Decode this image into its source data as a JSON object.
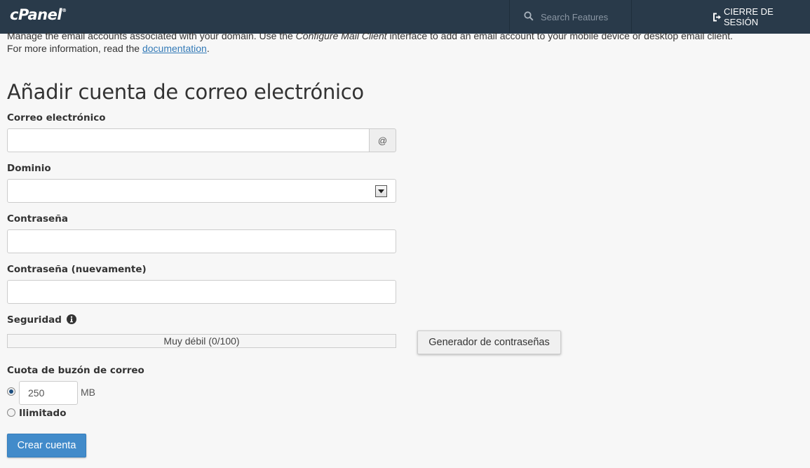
{
  "header": {
    "brand": "cPanel",
    "search_placeholder": "Search Features",
    "logout_label": "CIERRE DE SESIÓN"
  },
  "intro": {
    "line1_part1": "Manage the email accounts associated with your domain. Use the ",
    "line1_em": "Configure Mail Client",
    "line1_part2": " interface to add an email account to your mobile device or desktop email client.",
    "line2_prefix": "For more information, read the ",
    "link_text": "documentation",
    "line2_suffix": "."
  },
  "form": {
    "title": "Añadir cuenta de correo electrónico",
    "email_label": "Correo electrónico",
    "email_value": "",
    "email_addon": "@",
    "domain_label": "Dominio",
    "domain_value": "",
    "password_label": "Contraseña",
    "password_value": "",
    "password_again_label": "Contraseña (nuevamente)",
    "password_again_value": "",
    "security_label": "Seguridad",
    "strength_text": "Muy débil (0/100)",
    "strength_score": 0,
    "generator_button": "Generador de contraseñas",
    "quota_label": "Cuota de buzón de correo",
    "quota_value": "250",
    "quota_unit": "MB",
    "quota_mode_selected": "limited",
    "unlimited_label": "Ilimitado",
    "submit_button": "Crear cuenta"
  },
  "colors": {
    "topbar": "#293a4a",
    "primary": "#428bca",
    "link": "#337ab7"
  },
  "icons": [
    "search-icon",
    "logout-icon",
    "info-icon",
    "chevron-down-icon"
  ]
}
